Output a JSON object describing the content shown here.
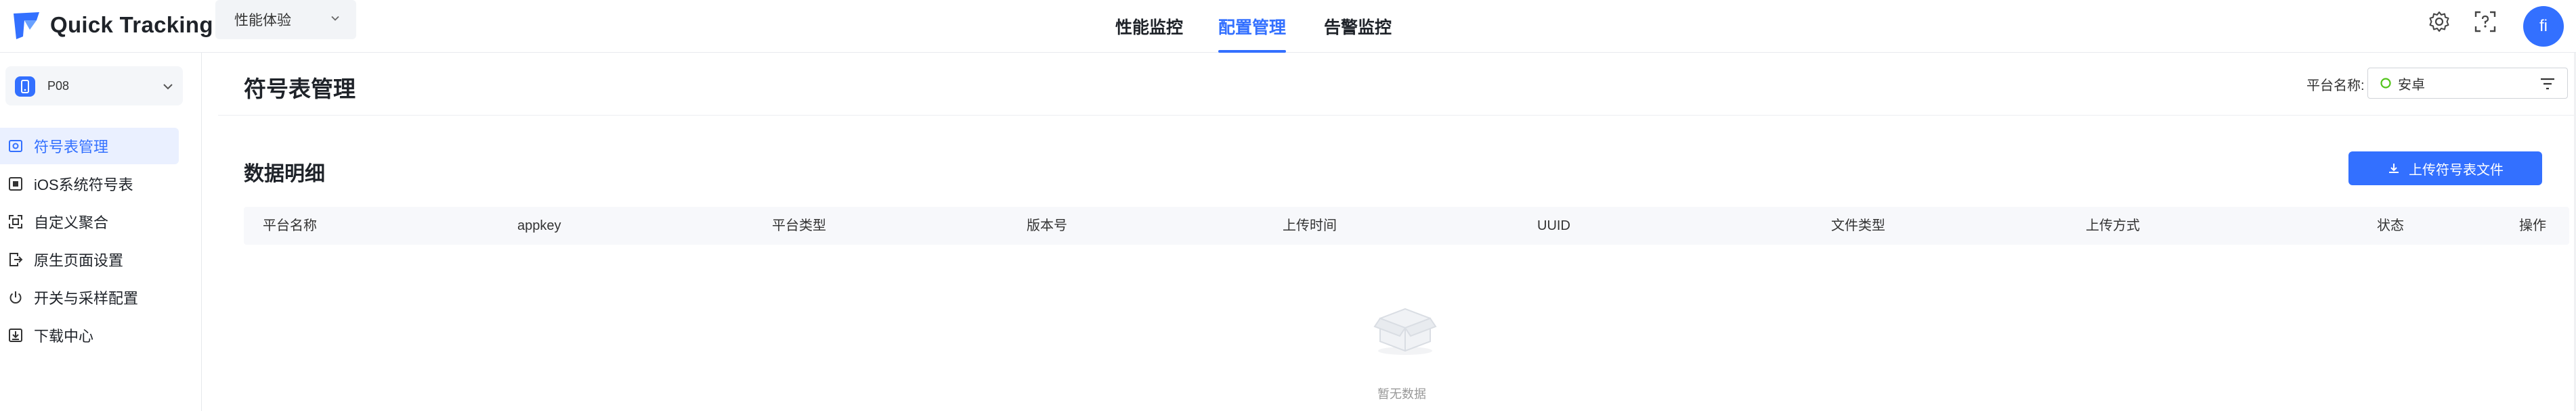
{
  "header": {
    "logo_text": "Quick Tracking",
    "app_selector": "性能体验",
    "nav": [
      {
        "label": "性能监控",
        "active": false
      },
      {
        "label": "配置管理",
        "active": true
      },
      {
        "label": "告警监控",
        "active": false
      }
    ],
    "avatar_initials": "fi",
    "icons": [
      "settings-icon",
      "scan-help-icon"
    ]
  },
  "sidebar": {
    "project": "P08",
    "items": [
      {
        "label": "符号表管理",
        "icon": "image-icon",
        "active": true
      },
      {
        "label": "iOS系统符号表",
        "icon": "square-icon",
        "active": false
      },
      {
        "label": "自定义聚合",
        "icon": "aggregate-icon",
        "active": false
      },
      {
        "label": "原生页面设置",
        "icon": "page-exit-icon",
        "active": false
      },
      {
        "label": "开关与采样配置",
        "icon": "power-icon",
        "active": false
      },
      {
        "label": "下载中心",
        "icon": "download-box-icon",
        "active": false
      }
    ]
  },
  "main": {
    "page_title": "符号表管理",
    "platform_label": "平台名称:",
    "platform_value": "安卓",
    "section_title": "数据明细",
    "upload_button": "上传符号表文件",
    "table_headers": [
      "平台名称",
      "appkey",
      "平台类型",
      "版本号",
      "上传时间",
      "UUID",
      "文件类型",
      "上传方式",
      "状态",
      "操作"
    ],
    "empty_text": "暂无数据"
  },
  "colors": {
    "accent": "#3370ff",
    "android": "#52c41a"
  }
}
